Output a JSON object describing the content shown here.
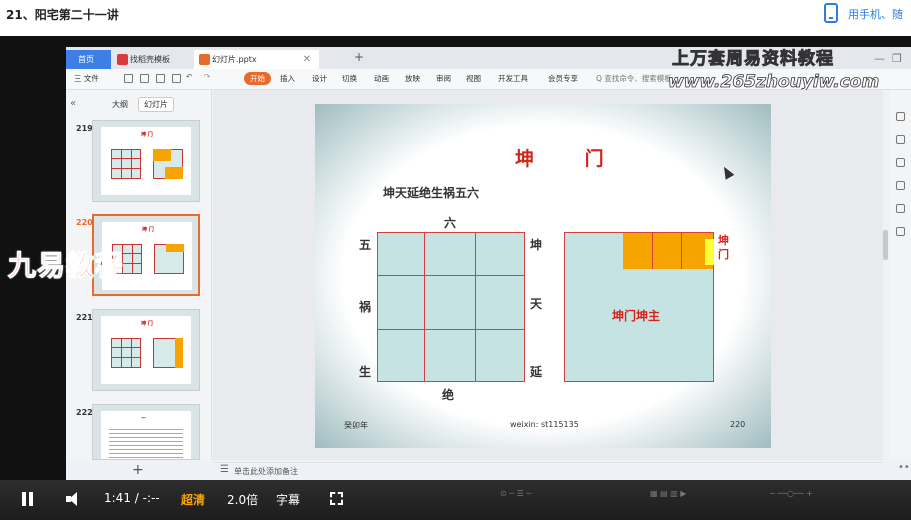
{
  "page": {
    "title": "21、阳宅第二十一讲",
    "mobile_link": "用手机、随"
  },
  "wps": {
    "tabs": {
      "home": "首页",
      "template": "找稻壳模板",
      "file": "幻灯片.pptx"
    },
    "menu": [
      "三 文件",
      "开始",
      "插入",
      "设计",
      "切换",
      "动画",
      "放映",
      "审阅",
      "视图",
      "开发工具",
      "会员专享",
      "Q 查找命令、搜索模板"
    ],
    "sidebar_tabs": {
      "outline": "大纲",
      "slides": "幻灯片"
    },
    "slide_numbers": [
      "219",
      "220",
      "221",
      "222"
    ],
    "notes_placeholder": "单击此处添加备注"
  },
  "watermarks": {
    "top": "上万套周易资料教程",
    "url": "www.265zhouyiw.com",
    "overlay": "九易教程"
  },
  "slide": {
    "title": "坤 门",
    "subtitle": "坤天延绝生祸五六",
    "grid_labels": {
      "top": "六",
      "left_top": "五",
      "left_mid": "祸",
      "left_bottom": "生",
      "bottom": "绝",
      "right_top": "坤",
      "right_mid": "天",
      "right_bottom": "延"
    },
    "door_label": "坤门",
    "center_label": "坤门坤主",
    "footer_left": "癸卯年",
    "footer_center": "weixin: st115135",
    "page_number": "220"
  },
  "player": {
    "time": "1:41 / -:--",
    "quality": "超清",
    "speed": "2.0倍",
    "subtitle": "字幕"
  },
  "colors": {
    "accent": "#e86a2c",
    "grid_fill": "#c6e3e4",
    "grid_line": "#d84040",
    "door_orange": "#f6a400",
    "title_red": "#d4231c",
    "link_blue": "#2b7de0"
  }
}
